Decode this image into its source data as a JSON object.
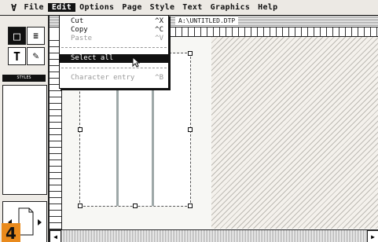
{
  "menubar": {
    "items": [
      "File",
      "Edit",
      "Options",
      "Page",
      "Style",
      "Text",
      "Graphics",
      "Help"
    ],
    "active": "Edit"
  },
  "document": {
    "title": "A:\\UNTITLED.DTP"
  },
  "edit_menu": {
    "items": [
      {
        "label": "Cut",
        "shortcut": "^X",
        "disabled": false
      },
      {
        "label": "Copy",
        "shortcut": "^C",
        "disabled": false
      },
      {
        "label": "Paste",
        "shortcut": "^V",
        "disabled": true
      },
      {
        "label": "Select all",
        "shortcut": "",
        "disabled": false,
        "highlighted": true
      },
      {
        "label": "Character entry",
        "shortcut": "^B",
        "disabled": true
      }
    ]
  },
  "toolbox": {
    "style_header": "STYLES"
  },
  "badge": {
    "number": "4"
  }
}
